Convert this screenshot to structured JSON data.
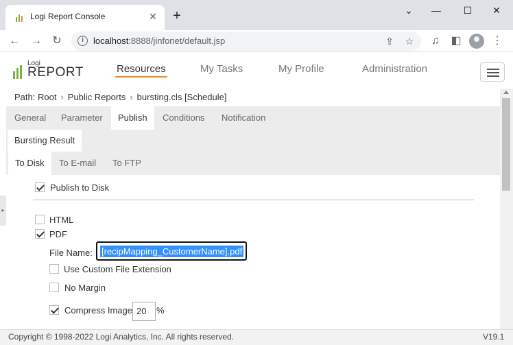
{
  "browser": {
    "tab_title": "Logi Report Console",
    "url_host": "localhost",
    "url_path": ":8888/jinfonet/default.jsp"
  },
  "app": {
    "logo_small": "Logi",
    "logo_big": "REPORT",
    "nav": [
      "Resources",
      "My Tasks",
      "My Profile",
      "Administration"
    ]
  },
  "breadcrumb": {
    "prefix": "Path: Root",
    "items": [
      "Public Reports",
      "bursting.cls [Schedule]"
    ]
  },
  "tabs": {
    "main": [
      "General",
      "Parameter",
      "Publish",
      "Conditions",
      "Notification"
    ],
    "sub": [
      "Bursting Result"
    ],
    "delivery": [
      "To Disk",
      "To E-mail",
      "To FTP"
    ]
  },
  "form": {
    "publish_to_disk": "Publish to Disk",
    "html": "HTML",
    "pdf": "PDF",
    "file_name_label": "File Name:",
    "file_name_value": "[recipMapping_CustomerName].pdf",
    "custom_ext": "Use Custom File Extension",
    "no_margin": "No Margin",
    "compress_image": "Compress Image",
    "compress_value": "20",
    "percent": "%"
  },
  "footer": {
    "copyright": "Copyright © 1998-2022 Logi Analytics, Inc. All rights reserved.",
    "version": "V19.1"
  },
  "colors": {
    "accent": "#f08a24",
    "selection": "#3390ff"
  }
}
